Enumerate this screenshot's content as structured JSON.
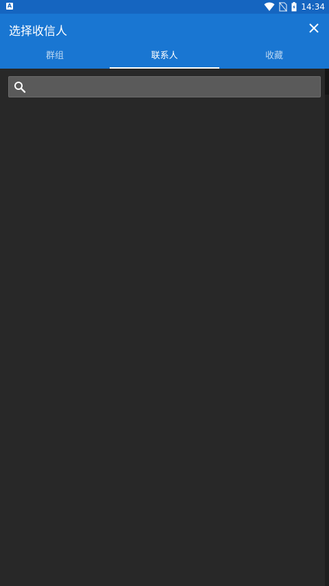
{
  "status_bar": {
    "time": "14:34",
    "notification_icon": "a-letter-icon",
    "notification_letter": "A",
    "icons": [
      "wifi-icon",
      "no-sim-icon",
      "battery-icon"
    ]
  },
  "app_bar": {
    "title": "选择收信人",
    "close_icon": "close-icon"
  },
  "tabs": [
    {
      "label": "群组",
      "active": false
    },
    {
      "label": "联系人",
      "active": true
    },
    {
      "label": "收藏",
      "active": false
    }
  ],
  "search": {
    "icon": "search-icon",
    "value": "",
    "placeholder": ""
  },
  "colors": {
    "status_bar": "#1565c0",
    "app_bar": "#1976d2",
    "background": "#282828",
    "search_box": "#5a5a5a"
  }
}
